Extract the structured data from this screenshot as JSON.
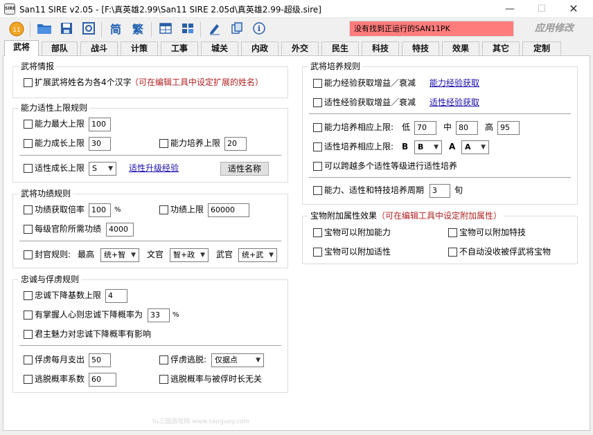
{
  "window": {
    "title": "San11 SIRE v2.05 - [F:\\真英雄2.99\\San11 SIRE 2.05d\\真英雄2.99-超级.sire]",
    "app_icon_text": "SIRE",
    "min": "—",
    "max": "☐",
    "close": "✕"
  },
  "toolbar": {
    "status": "没有找到正运行的SAN11PK",
    "apply_label": "应用修改",
    "status_color": "#ff7c7c",
    "tool_jian": "简",
    "tool_fan": "繁",
    "tool_info": "i"
  },
  "tabs": [
    "武将",
    "部队",
    "战斗",
    "计策",
    "工事",
    "城关",
    "内政",
    "外交",
    "民生",
    "科技",
    "特技",
    "效果",
    "其它",
    "定制"
  ],
  "left": {
    "info": {
      "title": "武将情报",
      "extend_name": "扩展武将姓名为各4个汉字",
      "extend_note": "（可在编辑工具中设定扩展的姓名）"
    },
    "aptitude_limit": {
      "title": "能力适性上限规则",
      "max_label": "能力最大上限",
      "max_value": "100",
      "growth_label": "能力成长上限",
      "growth_value": "30",
      "train_label": "能力培养上限",
      "train_value": "20",
      "apt_growth_label": "适性成长上限",
      "apt_growth_value": "S",
      "apt_upgrade_link": "适性升级经验",
      "apt_name_button": "适性名称"
    },
    "merit": {
      "title": "武将功绩规则",
      "rate_label": "功绩获取倍率",
      "rate_value": "100",
      "rate_unit": "%",
      "cap_label": "功绩上限",
      "cap_value": "60000",
      "per_rank_label": "每级官阶所需功绩",
      "per_rank_value": "4000",
      "rule_label": "封官规则:",
      "highest_label": "最高",
      "highest_value": "统+智",
      "civil_label": "文官",
      "civil_value": "智+政",
      "military_label": "武官",
      "military_value": "统+武"
    },
    "loyalty": {
      "title": "忠诚与俘虏规则",
      "drop_base_label": "忠诚下降基数上限",
      "drop_base_value": "4",
      "drop_prob_label": "有掌握人心则忠诚下降概率为",
      "drop_prob_value": "33",
      "drop_prob_unit": "%",
      "charm_label": "君主魅力对忠诚下降概率有影响",
      "monthly_label": "俘虏每月支出",
      "monthly_value": "50",
      "escape_label": "俘虏逃脱:",
      "escape_value": "仅据点",
      "escape_coef_label": "逃脱概率系数",
      "escape_coef_value": "60",
      "escape_time_label": "逃脱概率与被俘时长无关"
    }
  },
  "right": {
    "training": {
      "title": "武将培养规则",
      "ability_exp_label": "能力经验获取增益／衰减",
      "ability_exp_link": "能力经验获取",
      "apt_exp_label": "适性经验获取增益／衰减",
      "apt_exp_link": "适性经验获取",
      "ability_cap_label": "能力培养相应上限:",
      "low_label": "低",
      "low_value": "70",
      "mid_label": "中",
      "mid_value": "80",
      "high_label": "高",
      "high_value": "95",
      "apt_cap_label": "适性培养相应上限:",
      "b_label": "B",
      "b_value": "B",
      "a_label": "A",
      "a_value": "A",
      "cross_label": "可以跨越多个适性等级进行适性培养",
      "cycle_label": "能力、适性和特技培养周期",
      "cycle_value": "3",
      "cycle_unit": "旬"
    },
    "treasure": {
      "title": "宝物附加属性效果",
      "title_note": "（可在编辑工具中设定附加属性）",
      "ability": "宝物可以附加能力",
      "skill": "宝物可以附加特技",
      "aptitude": "宝物可以附加适性",
      "no_confiscate": "不自动没收被俘武将宝物"
    }
  },
  "watermark": "tu三国游戏网 www.sanguoy.com"
}
